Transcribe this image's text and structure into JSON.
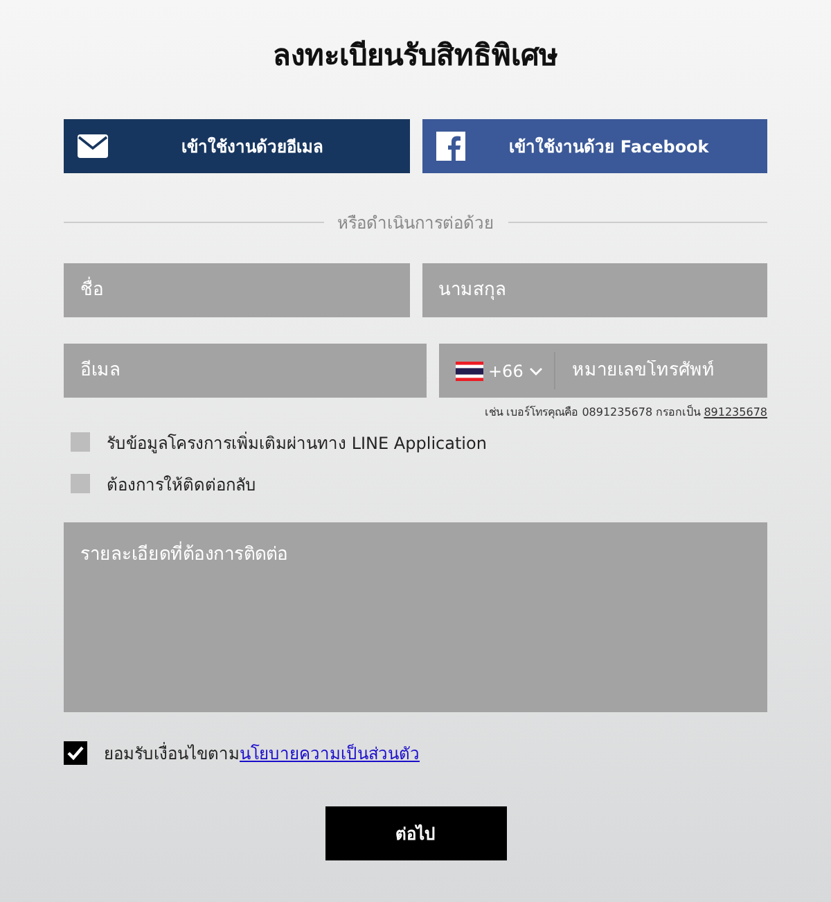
{
  "title": "ลงทะเบียนรับสิทธิพิเศษ",
  "social_buttons": [
    {
      "kind": "email",
      "label": "เข้าใช้งานด้วยอีเมล"
    },
    {
      "kind": "facebook",
      "label": "เข้าใช้งานด้วย Facebook"
    }
  ],
  "divider_text": "หรือดำเนินการต่อด้วย",
  "fields": {
    "first_name": {
      "placeholder": "ชื่อ"
    },
    "last_name": {
      "placeholder": "นามสกุล"
    },
    "email": {
      "placeholder": "อีเมล"
    },
    "phone": {
      "country_code": "+66",
      "placeholder": "หมายเลขโทรศัพท์"
    }
  },
  "phone_hint": {
    "text": "เช่น เบอร์โทรคุณคือ 0891235678 กรอกเป็น",
    "example": "891235678"
  },
  "options": [
    {
      "label": "รับข้อมูลโครงการเพิ่มเติมผ่านทาง LINE Application",
      "checked": false
    },
    {
      "label": "ต้องการให้ติดต่อกลับ",
      "checked": false
    }
  ],
  "message": {
    "placeholder": "รายละเอียดที่ต้องการติดต่อ"
  },
  "consent": {
    "text": "ยอมรับเงื่อนไขตาม",
    "link": "นโยบายความเป็นส่วนตัว",
    "checked": true
  },
  "submit": "ต่อไป"
}
